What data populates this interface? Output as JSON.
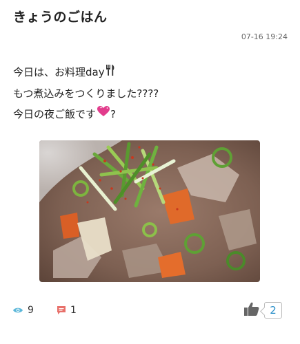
{
  "post": {
    "title": "きょうのごはん",
    "timestamp": "07-16 19:24",
    "lines": {
      "line1": "今日は、お料理day",
      "line2": "もつ煮込みをつくりました????",
      "line3_a": "今日の夜ご飯です",
      "line3_b": "?"
    },
    "image_alt": "もつ煮込み"
  },
  "footer": {
    "views": "9",
    "comments": "1",
    "likes": "2"
  },
  "icons": {
    "cutlery": "fork-knife-icon",
    "heart": "sparkling-heart-icon",
    "eye": "eye-icon",
    "comment": "comment-icon",
    "thumb": "thumbs-up-icon"
  },
  "colors": {
    "eye": "#5bb7d9",
    "comment": "#e8706a",
    "thumb": "#666666",
    "like_count": "#2a8fc9",
    "heart": "#e23c8c"
  }
}
